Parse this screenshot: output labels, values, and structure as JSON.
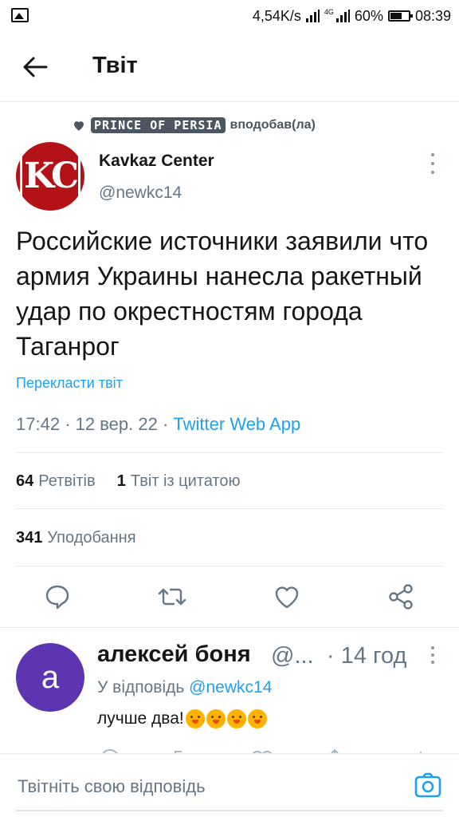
{
  "status_bar": {
    "speed": "4,54K/s",
    "network": "4G",
    "battery": "60%",
    "time": "08:39",
    "icons": [
      "image-icon",
      "signal-icon",
      "signal-4g-icon",
      "battery-icon"
    ]
  },
  "header": {
    "title": "Твіт",
    "back_icon": "arrow-left-icon"
  },
  "social_context": {
    "icon": "heart-icon",
    "user": "PRINCE OF PERSIA",
    "action": "вподобав(ла)"
  },
  "tweet": {
    "author_name": "Kavkaz Center",
    "author_handle": "@newkc14",
    "avatar_text": "KC",
    "text": "Российские источники заявили что армия Украины нанесла ракетный удар по окрестностям города Таганрог",
    "translate_label": "Перекласти твіт",
    "time": "17:42",
    "date": "12 вер. 22",
    "separator": "·",
    "source": "Twitter Web App",
    "retweets_count": "64",
    "retweets_label": "Ретвітів",
    "quotes_count": "1",
    "quotes_label": "Твіт із цитатою",
    "likes_count": "341",
    "likes_label": "Уподобання"
  },
  "actions": [
    "reply-icon",
    "retweet-icon",
    "like-icon",
    "share-icon"
  ],
  "reply": {
    "avatar_letter": "a",
    "name": "алексей боня",
    "handle": "@...",
    "time": "· 14 год",
    "reply_to_label": "У відповідь",
    "reply_to_handle": "@newkc14",
    "text": "лучше два!",
    "emoji_count": 4
  },
  "compose": {
    "placeholder": "Твітніть свою відповідь",
    "camera_icon": "camera-icon"
  },
  "colors": {
    "accent": "#1da1f2",
    "muted": "#657786",
    "text": "#14171a",
    "kc_red": "#b31217",
    "reply_avatar": "#5e35b1"
  }
}
